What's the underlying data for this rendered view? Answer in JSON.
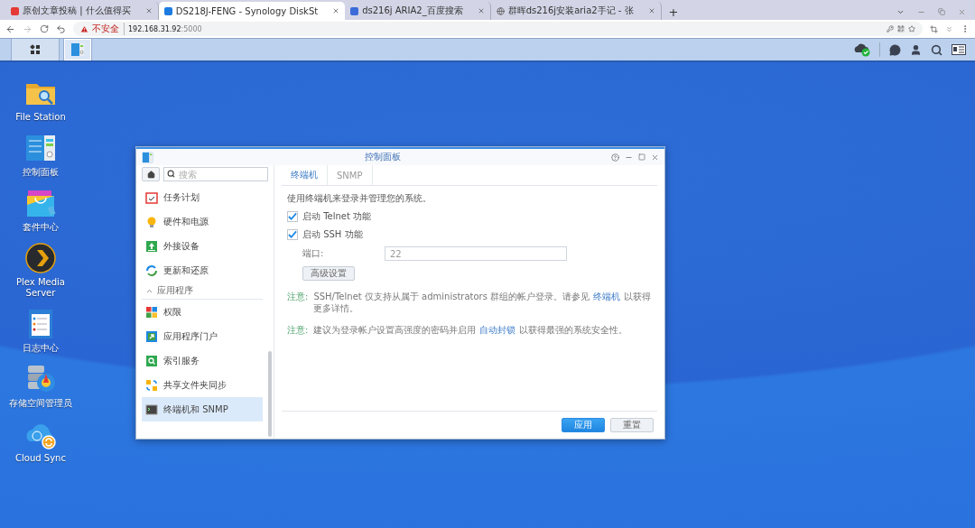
{
  "browser": {
    "tabs": [
      {
        "title": "原创文章投稿 | 什么值得买",
        "selected": false
      },
      {
        "title": "DS218J-FENG - Synology DiskSt",
        "selected": true
      },
      {
        "title": "ds216j ARIA2_百度搜索",
        "selected": false
      },
      {
        "title": "群晖ds216j安装aria2手记 - 张",
        "selected": false
      }
    ],
    "new_tab": "+",
    "address": {
      "security": "不安全",
      "host": "192.168.31.92",
      "port": ":5000"
    }
  },
  "taskbar": {
    "apps": [
      {
        "kind": "menu",
        "selected": false
      },
      {
        "kind": "control-panel",
        "selected": true
      }
    ]
  },
  "desktop": {
    "icons": [
      {
        "label": "File Station"
      },
      {
        "label": "控制面板"
      },
      {
        "label": "套件中心"
      },
      {
        "label": "Plex Media Server"
      },
      {
        "label": "日志中心"
      },
      {
        "label": "存储空间管理员"
      },
      {
        "label": "Cloud Sync"
      }
    ]
  },
  "window": {
    "title": "控制面板",
    "sidebar": {
      "search": {
        "placeholder": "搜索"
      },
      "items": [
        {
          "kind": "item",
          "label": "任务计划",
          "selected": false
        },
        {
          "kind": "item",
          "label": "硬件和电源",
          "selected": false
        },
        {
          "kind": "item",
          "label": "外接设备",
          "selected": false
        },
        {
          "kind": "item",
          "label": "更新和还原",
          "selected": false
        },
        {
          "kind": "section",
          "label": "应用程序",
          "expanded": true
        },
        {
          "kind": "item",
          "label": "权限",
          "selected": false
        },
        {
          "kind": "item",
          "label": "应用程序门户",
          "selected": false
        },
        {
          "kind": "item",
          "label": "索引服务",
          "selected": false
        },
        {
          "kind": "item",
          "label": "共享文件夹同步",
          "selected": false
        },
        {
          "kind": "item",
          "label": "终端机和 SNMP",
          "selected": true
        }
      ]
    },
    "tabs": [
      {
        "label": "终端机",
        "selected": true
      },
      {
        "label": "SNMP",
        "selected": false
      }
    ],
    "description": "使用终端机来登录并管理您的系统。",
    "options": [
      {
        "label": "启动 Telnet 功能",
        "checked": true
      },
      {
        "label": "启动 SSH 功能",
        "checked": true
      }
    ],
    "port": {
      "label": "端口:",
      "value": "22"
    },
    "advanced_button": "高级设置",
    "notes": [
      {
        "label": "注意:",
        "before": "SSH/Telnet 仅支持从属于 administrators 群组的帐户登录。请参见",
        "link": "终端机",
        "after": "以获得更多详情。"
      },
      {
        "label": "注意:",
        "before": "建议为登录帐户设置高强度的密码并启用",
        "link": "自动封锁",
        "after": "以获得最强的系统安全性。"
      }
    ],
    "buttons": [
      {
        "label": "应用",
        "kind": "primary"
      },
      {
        "label": "重置",
        "kind": "secondary"
      }
    ]
  }
}
